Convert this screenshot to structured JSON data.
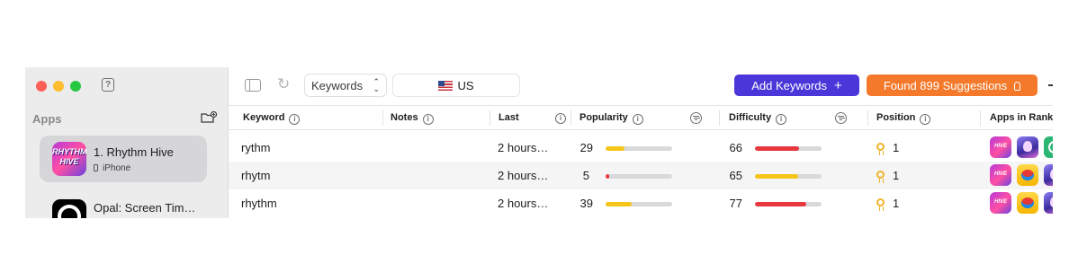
{
  "sidebar": {
    "apps_heading": "Apps",
    "apps": [
      {
        "name": "1. Rhythm Hive",
        "device": "iPhone",
        "icon": "rhythm-hive-app-icon",
        "icon_text": "RHYTHM HIVE",
        "selected": true
      },
      {
        "name": "Opal: Screen Tim…",
        "icon": "opal-app-icon",
        "selected": false
      }
    ]
  },
  "toolbar": {
    "view_select": "Keywords",
    "country": "US",
    "add_keywords_label": "Add Keywords",
    "suggestions_label": "Found 899 Suggestions"
  },
  "table": {
    "headers": {
      "keyword": "Keyword",
      "notes": "Notes",
      "last": "Last",
      "popularity": "Popularity",
      "difficulty": "Difficulty",
      "position": "Position",
      "apps_in_ranking": "Apps in Rankin"
    },
    "rows": [
      {
        "keyword": "rythm",
        "notes": "",
        "last": "2 hours…",
        "popularity": "29",
        "popularity_level": 0.29,
        "difficulty": "66",
        "difficulty_level": 0.66,
        "position": "1"
      },
      {
        "keyword": "rhytm",
        "notes": "",
        "last": "2 hours…",
        "popularity": "5",
        "popularity_level": 0.05,
        "difficulty": "65",
        "difficulty_level": 0.65,
        "position": "1"
      },
      {
        "keyword": "rhythm",
        "notes": "",
        "last": "2 hours…",
        "popularity": "39",
        "popularity_level": 0.39,
        "difficulty": "77",
        "difficulty_level": 0.77,
        "position": "1"
      }
    ]
  },
  "colors": {
    "accent_purple": "#4b37d9",
    "accent_orange": "#f4792b",
    "bar_yellow": "#f5c518",
    "bar_red": "#e8383d",
    "bar_track": "#d9d9dc"
  }
}
